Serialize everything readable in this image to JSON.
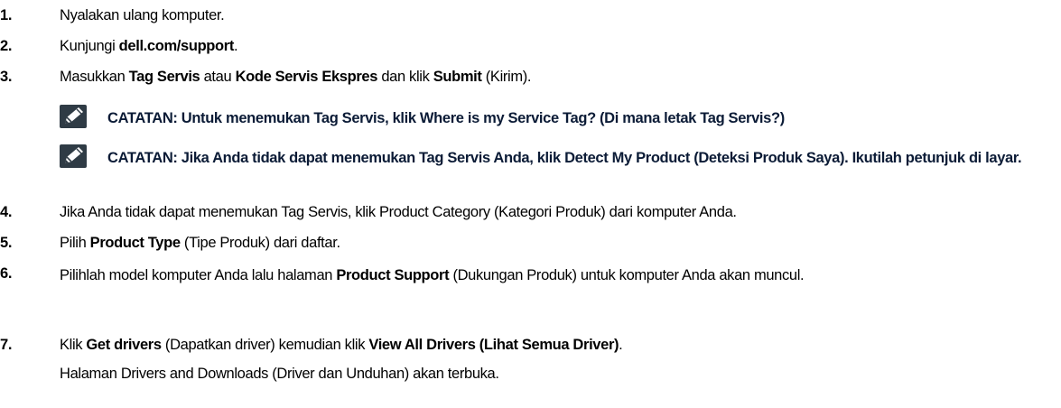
{
  "steps": [
    {
      "num": "1.",
      "parts": [
        {
          "t": "Nyalakan ulang komputer."
        }
      ]
    },
    {
      "num": "2.",
      "parts": [
        {
          "t": "Kunjungi "
        },
        {
          "t": "dell.com/support",
          "b": true
        },
        {
          "t": "."
        }
      ]
    },
    {
      "num": "3.",
      "parts": [
        {
          "t": "Masukkan "
        },
        {
          "t": "Tag Servis",
          "b": true
        },
        {
          "t": " atau "
        },
        {
          "t": "Kode Servis Ekspres",
          "b": true
        },
        {
          "t": " dan klik "
        },
        {
          "t": "Submit",
          "b": true
        },
        {
          "t": " (Kirim)."
        }
      ]
    },
    {
      "num": "4.",
      "parts": [
        {
          "t": "Jika Anda tidak dapat menemukan Tag Servis, klik Product Category (Kategori Produk) dari komputer Anda."
        }
      ]
    },
    {
      "num": "5.",
      "parts": [
        {
          "t": "Pilih "
        },
        {
          "t": "Product Type",
          "b": true
        },
        {
          "t": " (Tipe Produk) dari daftar."
        }
      ]
    },
    {
      "num": "6.",
      "parts": [
        {
          "t": "Pilihlah model komputer Anda lalu halaman "
        },
        {
          "t": "Product Support",
          "b": true
        },
        {
          "t": " (Dukungan Produk) untuk komputer Anda akan muncul."
        }
      ]
    },
    {
      "num": "7.",
      "parts": [
        {
          "t": "Klik "
        },
        {
          "t": "Get drivers",
          "b": true
        },
        {
          "t": " (Dapatkan driver) kemudian klik "
        },
        {
          "t": "View All Drivers (Lihat Semua Driver)",
          "b": true
        },
        {
          "t": "."
        }
      ]
    }
  ],
  "notes": [
    "CATATAN: Untuk menemukan Tag Servis, klik Where is my Service Tag? (Di mana letak Tag Servis?)",
    "CATATAN: Jika Anda tidak dapat menemukan Tag Servis Anda, klik Detect My Product (Deteksi Produk Saya). Ikutilah petunjuk di layar."
  ],
  "step7_follow": "Halaman Drivers and Downloads (Driver dan Unduhan) akan terbuka.",
  "note_icon": "pencil-note-icon",
  "colors": {
    "text": "#000000",
    "note_text": "#0b1b36",
    "icon_bg": "#2f3b45"
  }
}
